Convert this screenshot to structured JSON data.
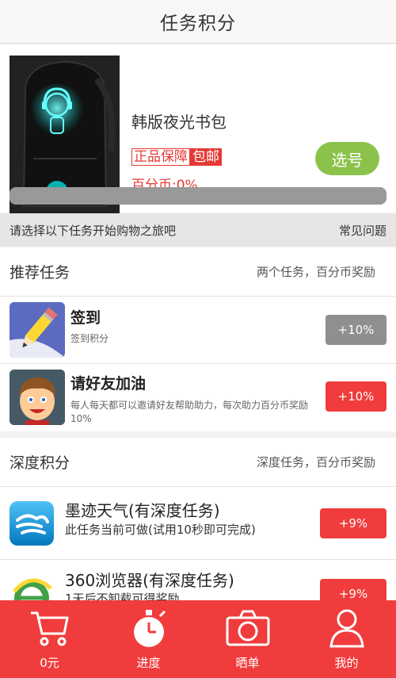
{
  "header": {
    "title": "任务积分"
  },
  "product": {
    "name": "韩版夜光书包",
    "tag_genuine": "正品保障",
    "tag_shipping": "包邮",
    "coin_text": "百分币:0%",
    "select_label": "选号",
    "progress_fraction": 0
  },
  "intro": {
    "text": "请选择以下任务开始购物之旅吧",
    "faq": "常见问题"
  },
  "recommended": {
    "title": "推荐任务",
    "subtitle": "两个任务，百分币奖励",
    "tasks": [
      {
        "title": "签到",
        "desc": "签到积分",
        "button": "+10%",
        "icon": "pencil-icon"
      },
      {
        "title": "请好友加油",
        "desc": "每人每天都可以邀请好友帮助助力，每次助力百分币奖励10%",
        "button": "+10%",
        "icon": "boy-avatar-icon"
      }
    ]
  },
  "deep": {
    "title": "深度积分",
    "subtitle": "深度任务，百分币奖励",
    "tasks": [
      {
        "title": "墨迹天气(有深度任务)",
        "desc": "此任务当前可做(试用10秒即可完成)",
        "button": "+9%",
        "icon": "moji-weather-icon"
      },
      {
        "title": "360浏览器(有深度任务)",
        "desc": "1天后不卸载可得奖励",
        "button": "+9%",
        "icon": "360-browser-icon"
      }
    ]
  },
  "nav": [
    {
      "label": "0元",
      "icon": "cart-icon"
    },
    {
      "label": "进度",
      "icon": "stopwatch-icon"
    },
    {
      "label": "晒单",
      "icon": "camera-icon"
    },
    {
      "label": "我的",
      "icon": "user-icon"
    }
  ],
  "colors": {
    "accent_red": "#f03c3c",
    "green_button": "#8bc34a",
    "gray_button": "#8f8f8f"
  }
}
